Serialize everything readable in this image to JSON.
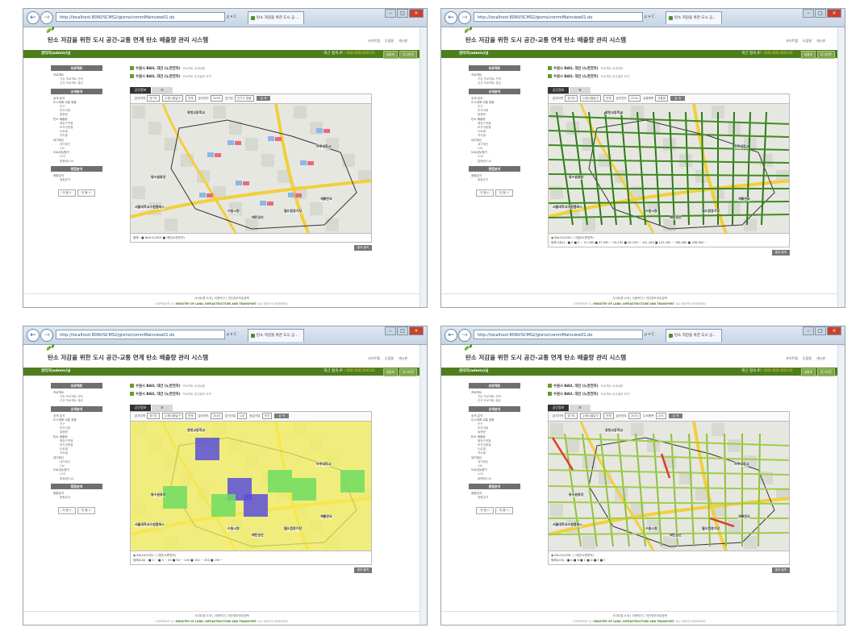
{
  "browser": {
    "address": "http://localhost:8090/SCMS2/gisms/commMainview01.do",
    "tab_title": "탄소 저감을 위한 도시 공…",
    "nav_back": "←",
    "nav_fwd": "→",
    "addr_ctl": "ρ ▾ C"
  },
  "header": {
    "title": "탄소 저감을 위한 도시 공간-교통 연계 탄소 배출량 관리 시스템",
    "links": [
      "사이트맵",
      "도움말",
      "게시판"
    ]
  },
  "userbar": {
    "user": "관리자(admin)님",
    "ip_label": "최근 접속 IP :",
    "ip_value": "000.000.000.01",
    "btn_info": "내정보",
    "btn_logout": "로그아웃"
  },
  "sidebar": {
    "project_header": "프로젝트",
    "project_items": [
      "프로젝트",
      "기존 프로젝트 선택",
      "신규 프로젝트 생성"
    ],
    "detail_header": "상세분석",
    "detail_items": [
      {
        "label": "상세 분석",
        "cls": ""
      },
      {
        "label": "도시계획·교통 현황",
        "cls": ""
      },
      {
        "label": "인구",
        "cls": "sub"
      },
      {
        "label": "토지이용",
        "cls": "sub"
      },
      {
        "label": "통행량",
        "cls": "sub"
      },
      {
        "label": "탄소 배출량",
        "cls": ""
      },
      {
        "label": "행정구역별",
        "cls": "sub"
      },
      {
        "label": "토지이용별",
        "cls": "sub"
      },
      {
        "label": "도로별",
        "cls": "sub"
      },
      {
        "label": "격자별",
        "cls": "sub"
      },
      {
        "label": "대기확산",
        "cls": ""
      },
      {
        "label": "대기확산",
        "cls": "sub"
      },
      {
        "label": "CAI",
        "cls": "sub"
      },
      {
        "label": "도로성능평가",
        "cls": ""
      },
      {
        "label": "LOS",
        "cls": "sub"
      },
      {
        "label": "통행량/CAI",
        "cls": "sub"
      }
    ],
    "overall_header": "종합분석",
    "overall_items": [
      "종합분석",
      "종합분석"
    ],
    "btn_prev": "이 동 ←",
    "btn_next": "이 동 →"
  },
  "content": {
    "row1": "수원시 BAU, 대안 (노면전차)",
    "row1_note": "프로젝트 상세내용",
    "row2": "수원시 BAU, 대안 (노면전차)",
    "row2_note": "프로젝트 분석결과 요약",
    "tab_on": "공간정보",
    "tab_off": "표",
    "print": "결과 출력"
  },
  "panels": [
    {
      "filter": [
        "분석지역",
        "경기도",
        "수원시팔달구",
        "전체",
        "분석연도",
        "2030",
        "업구분",
        "인구수 현황",
        "검 색"
      ],
      "legend": "범례 : ■ BAU시나리오 ■ 대안(노면전차)",
      "radio": ""
    },
    {
      "filter": [
        "분석지역",
        "경기도",
        "수원시팔달구",
        "전체",
        "분석연도",
        "2030",
        "공통항목",
        "교통량",
        "검 색"
      ],
      "legend": "범례 (대수) : ■ 0  ■ 0 ~ 47,095  ■ 47,095 ~ 94,190  ■ 94,190 ~ 141,285  ■ 141,285 ~ 188,380  ■ 188,380 ~",
      "radio": "◉ BAU시나리오  ○ 대안(노면전차)"
    },
    {
      "filter": [
        "분석지역",
        "경기도",
        "수원시팔달구",
        "전체",
        "분석연도",
        "2030",
        "분석구분",
        "CAI",
        "등급구분",
        "격자",
        "검 색"
      ],
      "legend": "범례(CAI) : ■ 0 ~  ■ 0 ~ 50  ■ 50 ~ 100  ■ 100 ~ 250  ■ 250 ~",
      "radio": "◉ BAU시나리오  ○ 대안(노면전차)"
    },
    {
      "filter": [
        "분석지역",
        "경기도",
        "수원시팔달구",
        "전체",
        "분석연도",
        "2030",
        "LOS항목",
        "LOS",
        "검 색"
      ],
      "legend": "범례(LOS) : ■ A ■ B ■ C ■ D ■ E ■ F",
      "radio": "◉ BAU시나리오  ○ 대안(노면전차)"
    }
  ],
  "map_labels": [
    "창현교등학교",
    "아주대학교",
    "동수원중앙",
    "수원시청",
    "매탄권선",
    "계룡한국",
    "월드컵경기장",
    "서울대학교수원캠퍼스"
  ],
  "footer": {
    "links": "사이트맵 소개  |  이용약관  |  개인정보보호정책",
    "copy_prefix": "COPYRIGHT (C)",
    "copy_org": "MINISTRY OF LAND, INFRASTRUCTURE AND TRANSPORT",
    "copy_suffix": ". ALL RIGHTS RESERVED."
  },
  "colors": {
    "brand_green": "#4e7d1d",
    "bau": "#8fb6e8",
    "alt": "#e86a7a"
  }
}
